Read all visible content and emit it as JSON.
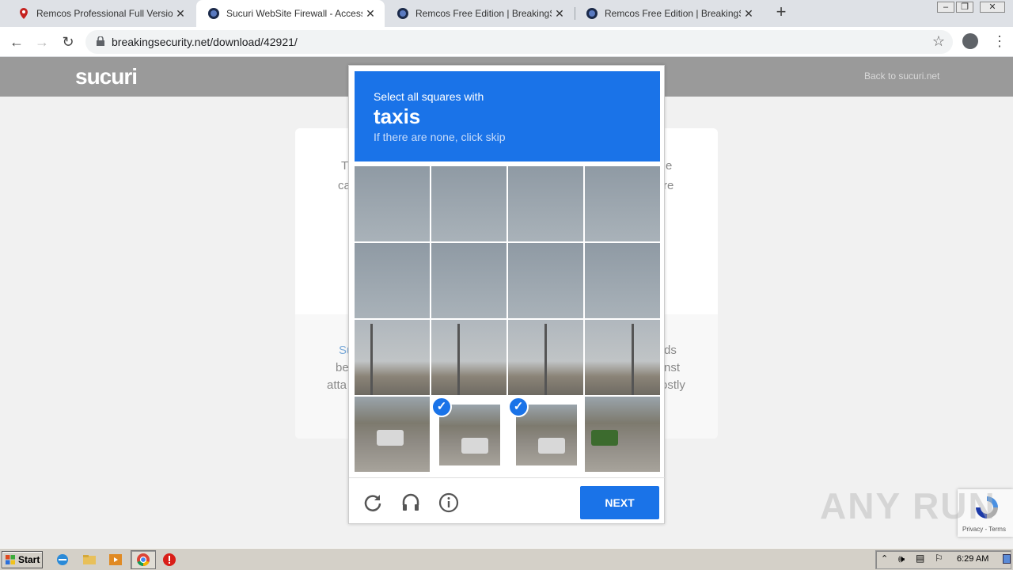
{
  "browser": {
    "tabs": [
      {
        "title": "Remcos Professional Full Version Do",
        "icon": "map-pin-icon",
        "active": false
      },
      {
        "title": "Sucuri WebSite Firewall - Access Den",
        "icon": "globe-icon",
        "active": true
      },
      {
        "title": "Remcos Free Edition | BreakingSecur",
        "icon": "globe-icon",
        "active": false
      },
      {
        "title": "Remcos Free Edition | BreakingSecur",
        "icon": "globe-icon",
        "active": false
      }
    ],
    "new_tab_label": "+",
    "url": "breakingsecurity.net/download/42921/",
    "window_controls": [
      "minimize",
      "maximize",
      "close"
    ]
  },
  "page": {
    "logo": "sucuri",
    "back_link": "Back to sucuri.net",
    "background_fragments": [
      "T",
      "ca",
      "e",
      "re",
      "Su",
      "be",
      "atta",
      "ds",
      "nst",
      "ostly"
    ]
  },
  "captcha": {
    "prompt": "Select all squares with",
    "target": "taxis",
    "hint": "If there are none, click skip",
    "selected_cells": [
      13,
      14
    ],
    "next_label": "NEXT",
    "footer_icons": [
      "reload-icon",
      "headphones-icon",
      "info-icon"
    ]
  },
  "recaptcha_badge": {
    "terms": "Privacy - Terms"
  },
  "watermark": "ANY RUN",
  "taskbar": {
    "start_label": "Start",
    "clock": "6:29 AM"
  },
  "colors": {
    "accent": "#1a73e8",
    "header_gray": "#9a9a9a"
  }
}
